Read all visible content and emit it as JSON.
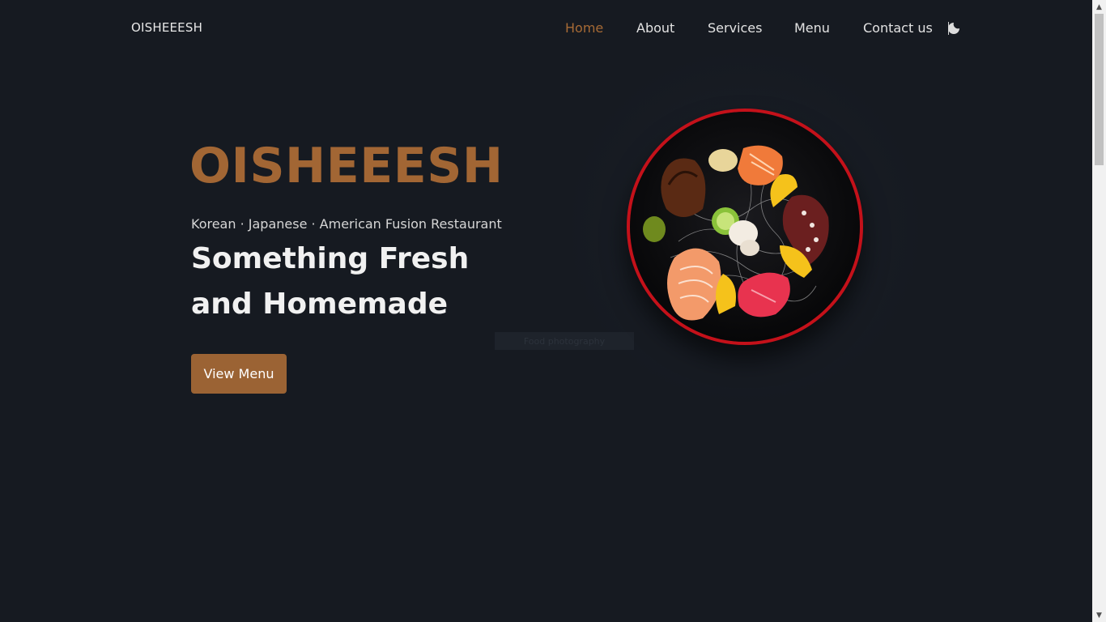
{
  "header": {
    "logo": "OISHEEESH",
    "nav": [
      {
        "label": "Home",
        "active": true
      },
      {
        "label": "About",
        "active": false
      },
      {
        "label": "Services",
        "active": false
      },
      {
        "label": "Menu",
        "active": false
      },
      {
        "label": "Contact us",
        "active": false
      }
    ],
    "theme_toggle_icon": "moon-icon"
  },
  "hero": {
    "title": "OISHEEESH",
    "subtitle": "Korean · Japanese · American Fusion Restaurant",
    "heading_line1": "Something Fresh",
    "heading_line2": "and Homemade",
    "cta_label": "View Menu",
    "image_caption": "Food photography"
  },
  "colors": {
    "background": "#161a21",
    "accent": "#a26634",
    "button": "#9b6334",
    "plate_rim": "#c4111a"
  },
  "scrollbar": {
    "up_icon": "▲",
    "down_icon": "▼"
  }
}
